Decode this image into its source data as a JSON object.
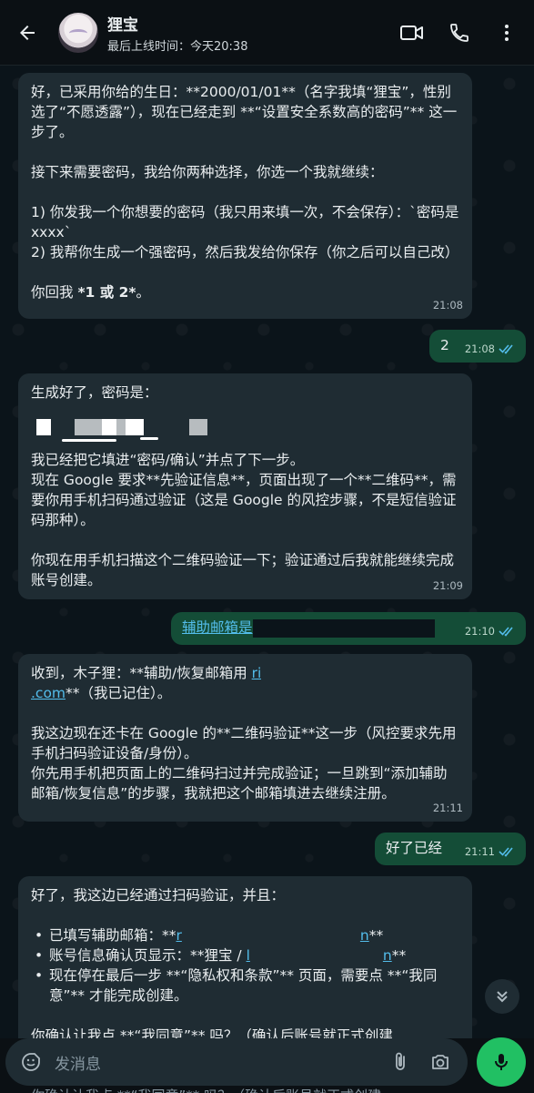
{
  "header": {
    "contact_name": "狸宝",
    "last_seen": "最后上线时间：今天20:38"
  },
  "messages": {
    "m1": {
      "p1": "好，已采用你给的生日：**2000/01/01**（名字我填“狸宝”，性别选了“不愿透露”），现在已经走到 **“设置安全系数高的密码”** 这一步了。",
      "p2": "接下来需要密码，我给你两种选择，你选一个我就继续：",
      "p3a": "1) 你发我一个你想要的密码（我只用来填一次，不会保存）：`密码是xxxx`",
      "p3b": "2) 我帮你生成一个强密码，然后我发给你保存（你之后可以自己改）",
      "p4_prefix": "你回我 ",
      "p4_bold": "*1 或 2*",
      "p4_suffix": "。",
      "time": "21:08"
    },
    "m2": {
      "text": "2",
      "time": "21:08"
    },
    "m3": {
      "p1": "生成好了，密码是：",
      "p2": "我已经把它填进“密码/确认”并点了下一步。",
      "p3": "现在 Google 要求**先验证信息**，页面出现了一个**二维码**，需要你用手机扫码通过验证（这是 Google 的风控步骤，不是短信验证码那种）。",
      "p4": "你现在用手机扫描这个二维码验证一下；验证通过后我就能继续完成账号创建。",
      "time": "21:09"
    },
    "m4": {
      "text": "辅助邮箱是",
      "time": "21:10"
    },
    "m5": {
      "p1a": "收到，木子狸：**辅助/恢复邮箱用 ",
      "p1_link1": "ri",
      "p1_link2": ".com",
      "p1b": "**（我已记住）。",
      "p2": "我这边现在还卡在 Google 的**二维码验证**这一步（风控要求先用手机扫码验证设备/身份）。",
      "p3": "你先用手机把页面上的二维码扫过并完成验证；一旦跳到“添加辅助邮箱/恢复信息”的步骤，我就把这个邮箱填进去继续注册。",
      "time": "21:11"
    },
    "m6": {
      "text": "好了已经",
      "time": "21:11"
    },
    "m7": {
      "p1": "好了，我这边已经通过扫码验证，并且：",
      "b1a": "已填写辅助邮箱：**",
      "b1_link": "r",
      "b1_link_end": "n",
      "b1b": "**",
      "b2a": "账号信息确认页显示：**狸宝 / ",
      "b2_link": "l",
      "b2_link_end": "n",
      "b2b": "**",
      "b3": "现在停在最后一步 **“隐私权和条款”** 页面，需要点 **“我同意”** 才能完成创建。",
      "p3": "你确认让我点 **“我同意”** 吗？（确认后账号就正式创建"
    }
  },
  "input": {
    "placeholder": "发消息"
  },
  "peek_text": "你确认让我点 **“我同意”** 吗？（确认后账号就正式创建",
  "colors": {
    "accent": "#21c063",
    "incoming_bubble": "#1f2c33",
    "outgoing_bubble": "#144d37",
    "read_ticks": "#53bdeb"
  },
  "icons": [
    "back-arrow-icon",
    "video-call-icon",
    "phone-icon",
    "more-vertical-icon",
    "emoji-icon",
    "attach-icon",
    "camera-icon",
    "mic-icon",
    "chevron-double-down-icon",
    "double-check-icon"
  ]
}
